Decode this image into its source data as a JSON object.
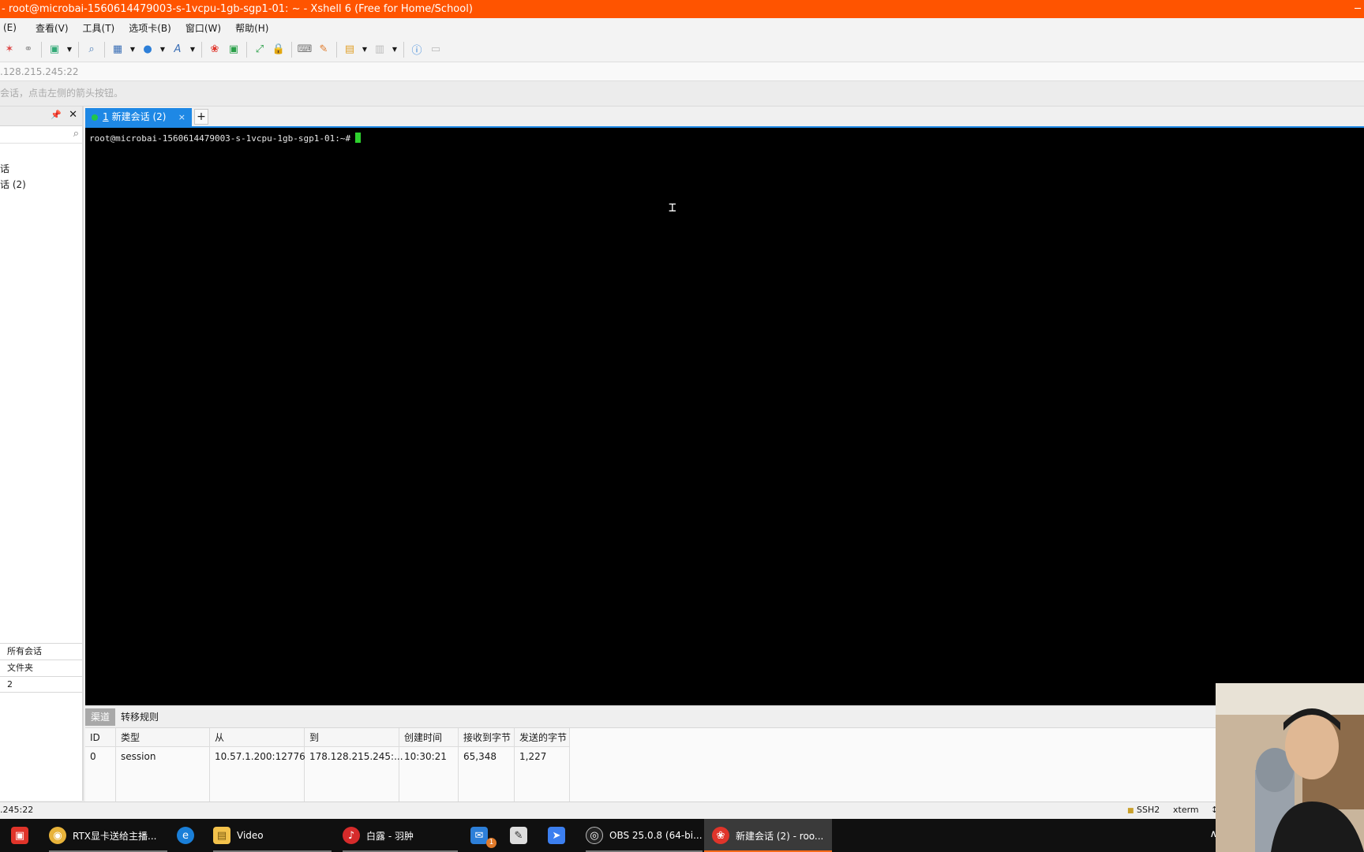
{
  "window": {
    "title": "- root@microbai-1560614479003-s-1vcpu-1gb-sgp1-01: ~ - Xshell 6 (Free for Home/School)",
    "accent": "#ff5400",
    "right_glyph": "─"
  },
  "menu": [
    "(E)",
    "查看(V)",
    "工具(T)",
    "选项卡(B)",
    "窗口(W)",
    "帮助(H)"
  ],
  "address": ".128.215.245:22",
  "hint": "会话，点击左侧的箭头按钮。",
  "sidebar": {
    "tree": [
      "话",
      "话 (2)"
    ],
    "props": [
      "所有会话",
      "文件夹",
      "2"
    ]
  },
  "tab": {
    "num": "1",
    "label": "新建会话 (2)",
    "close": "×",
    "add": "+"
  },
  "terminal": {
    "prompt": "root@microbai-1560614479003-s-1vcpu-1gb-sgp1-01:~#"
  },
  "panel": {
    "tabs": [
      "渠道",
      "转移规则"
    ],
    "headers": [
      "ID",
      "类型",
      "从",
      "到",
      "创建时间",
      "接收到字节",
      "发送的字节"
    ],
    "rows": [
      [
        "0",
        "session",
        "10.57.1.200:12776",
        "178.128.215.245:...",
        "10:30:21",
        "65,348",
        "1,227"
      ]
    ]
  },
  "status": {
    "left": ".245:22",
    "protocol": "SSH2",
    "term": "xterm",
    "size": "↕"
  },
  "taskbar": {
    "items": [
      {
        "label": "",
        "icon": "store-icon"
      },
      {
        "label": "RTX显卡送给主播...",
        "icon": "chrome-icon"
      },
      {
        "label": "",
        "icon": "edge-icon"
      },
      {
        "label": "Video",
        "icon": "folder-icon"
      },
      {
        "label": "白露 - 羽肿",
        "icon": "netease-music-icon"
      },
      {
        "label": "",
        "icon": "mail-icon"
      },
      {
        "label": "",
        "icon": "notepad-icon"
      },
      {
        "label": "",
        "icon": "feishu-icon"
      },
      {
        "label": "OBS 25.0.8 (64-bi...",
        "icon": "obs-icon"
      },
      {
        "label": "新建会话 (2) - roo...",
        "icon": "xshell-icon"
      }
    ],
    "mail_badge": "1",
    "tray_chevron": "∧"
  }
}
